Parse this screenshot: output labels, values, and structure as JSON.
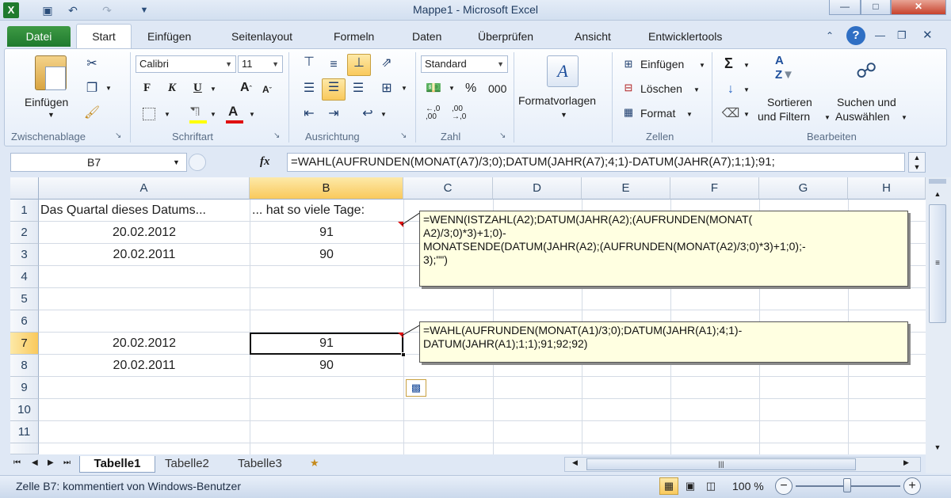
{
  "window": {
    "title": "Mappe1 - Microsoft Excel",
    "app_icon": "excel-icon"
  },
  "ribbon_tabs": {
    "file": "Datei",
    "items": [
      "Start",
      "Einfügen",
      "Seitenlayout",
      "Formeln",
      "Daten",
      "Überprüfen",
      "Ansicht",
      "Entwicklertools"
    ]
  },
  "clipboard": {
    "paste": "Einfügen",
    "group": "Zwischenablage"
  },
  "font": {
    "name": "Calibri",
    "size": "11",
    "group": "Schriftart",
    "bold": "F",
    "italic": "K",
    "underline": "U"
  },
  "alignment": {
    "group": "Ausrichtung"
  },
  "number": {
    "format": "Standard",
    "percent": "%",
    "thousands": "000",
    "group": "Zahl"
  },
  "styles": {
    "label": "Formatvorlagen"
  },
  "cells_group": {
    "insert": "Einfügen",
    "delete": "Löschen",
    "format": "Format",
    "group": "Zellen"
  },
  "editing": {
    "sort_line1": "Sortieren",
    "sort_line2": "und Filtern",
    "find_line1": "Suchen und",
    "find_line2": "Auswählen",
    "group": "Bearbeiten",
    "sum": "Σ"
  },
  "formula_bar": {
    "name_box": "B7",
    "fx": "fx",
    "formula": "=WAHL(AUFRUNDEN(MONAT(A7)/3;0);DATUM(JAHR(A7);4;1)-DATUM(JAHR(A7);1;1);91;"
  },
  "columns": [
    "A",
    "B",
    "C",
    "D",
    "E",
    "F",
    "G",
    "H"
  ],
  "rows": [
    "1",
    "2",
    "3",
    "4",
    "5",
    "6",
    "7",
    "8",
    "9",
    "10",
    "11"
  ],
  "cells": {
    "A1": "Das Quartal dieses Datums...",
    "B1": "... hat so viele Tage:",
    "A2": "20.02.2012",
    "B2": "91",
    "A3": "20.02.2011",
    "B3": "90",
    "A7": "20.02.2012",
    "B7": "91",
    "A8": "20.02.2011",
    "B8": "90"
  },
  "comments": {
    "b2_lines": [
      "=WENN(ISTZAHL(A2);DATUM(JAHR(A2);(AUFRUNDEN(MONAT(",
      "A2)/3;0)*3)+1;0)-",
      "MONATSENDE(DATUM(JAHR(A2);(AUFRUNDEN(MONAT(A2)/3;0)*3)+1;0);-",
      "3);\"\")"
    ],
    "b7_lines": [
      "=WAHL(AUFRUNDEN(MONAT(A1)/3;0);DATUM(JAHR(A1);4;1)-",
      "DATUM(JAHR(A1);1;1);91;92;92)"
    ]
  },
  "sheet_tabs": [
    "Tabelle1",
    "Tabelle2",
    "Tabelle3"
  ],
  "status": {
    "text": "Zelle B7: kommentiert von Windows-Benutzer",
    "zoom": "100 %"
  },
  "colors": {
    "excel_green": "#1f7a2e",
    "selection": "#f9c95c",
    "comment_bg": "#ffffe1"
  }
}
